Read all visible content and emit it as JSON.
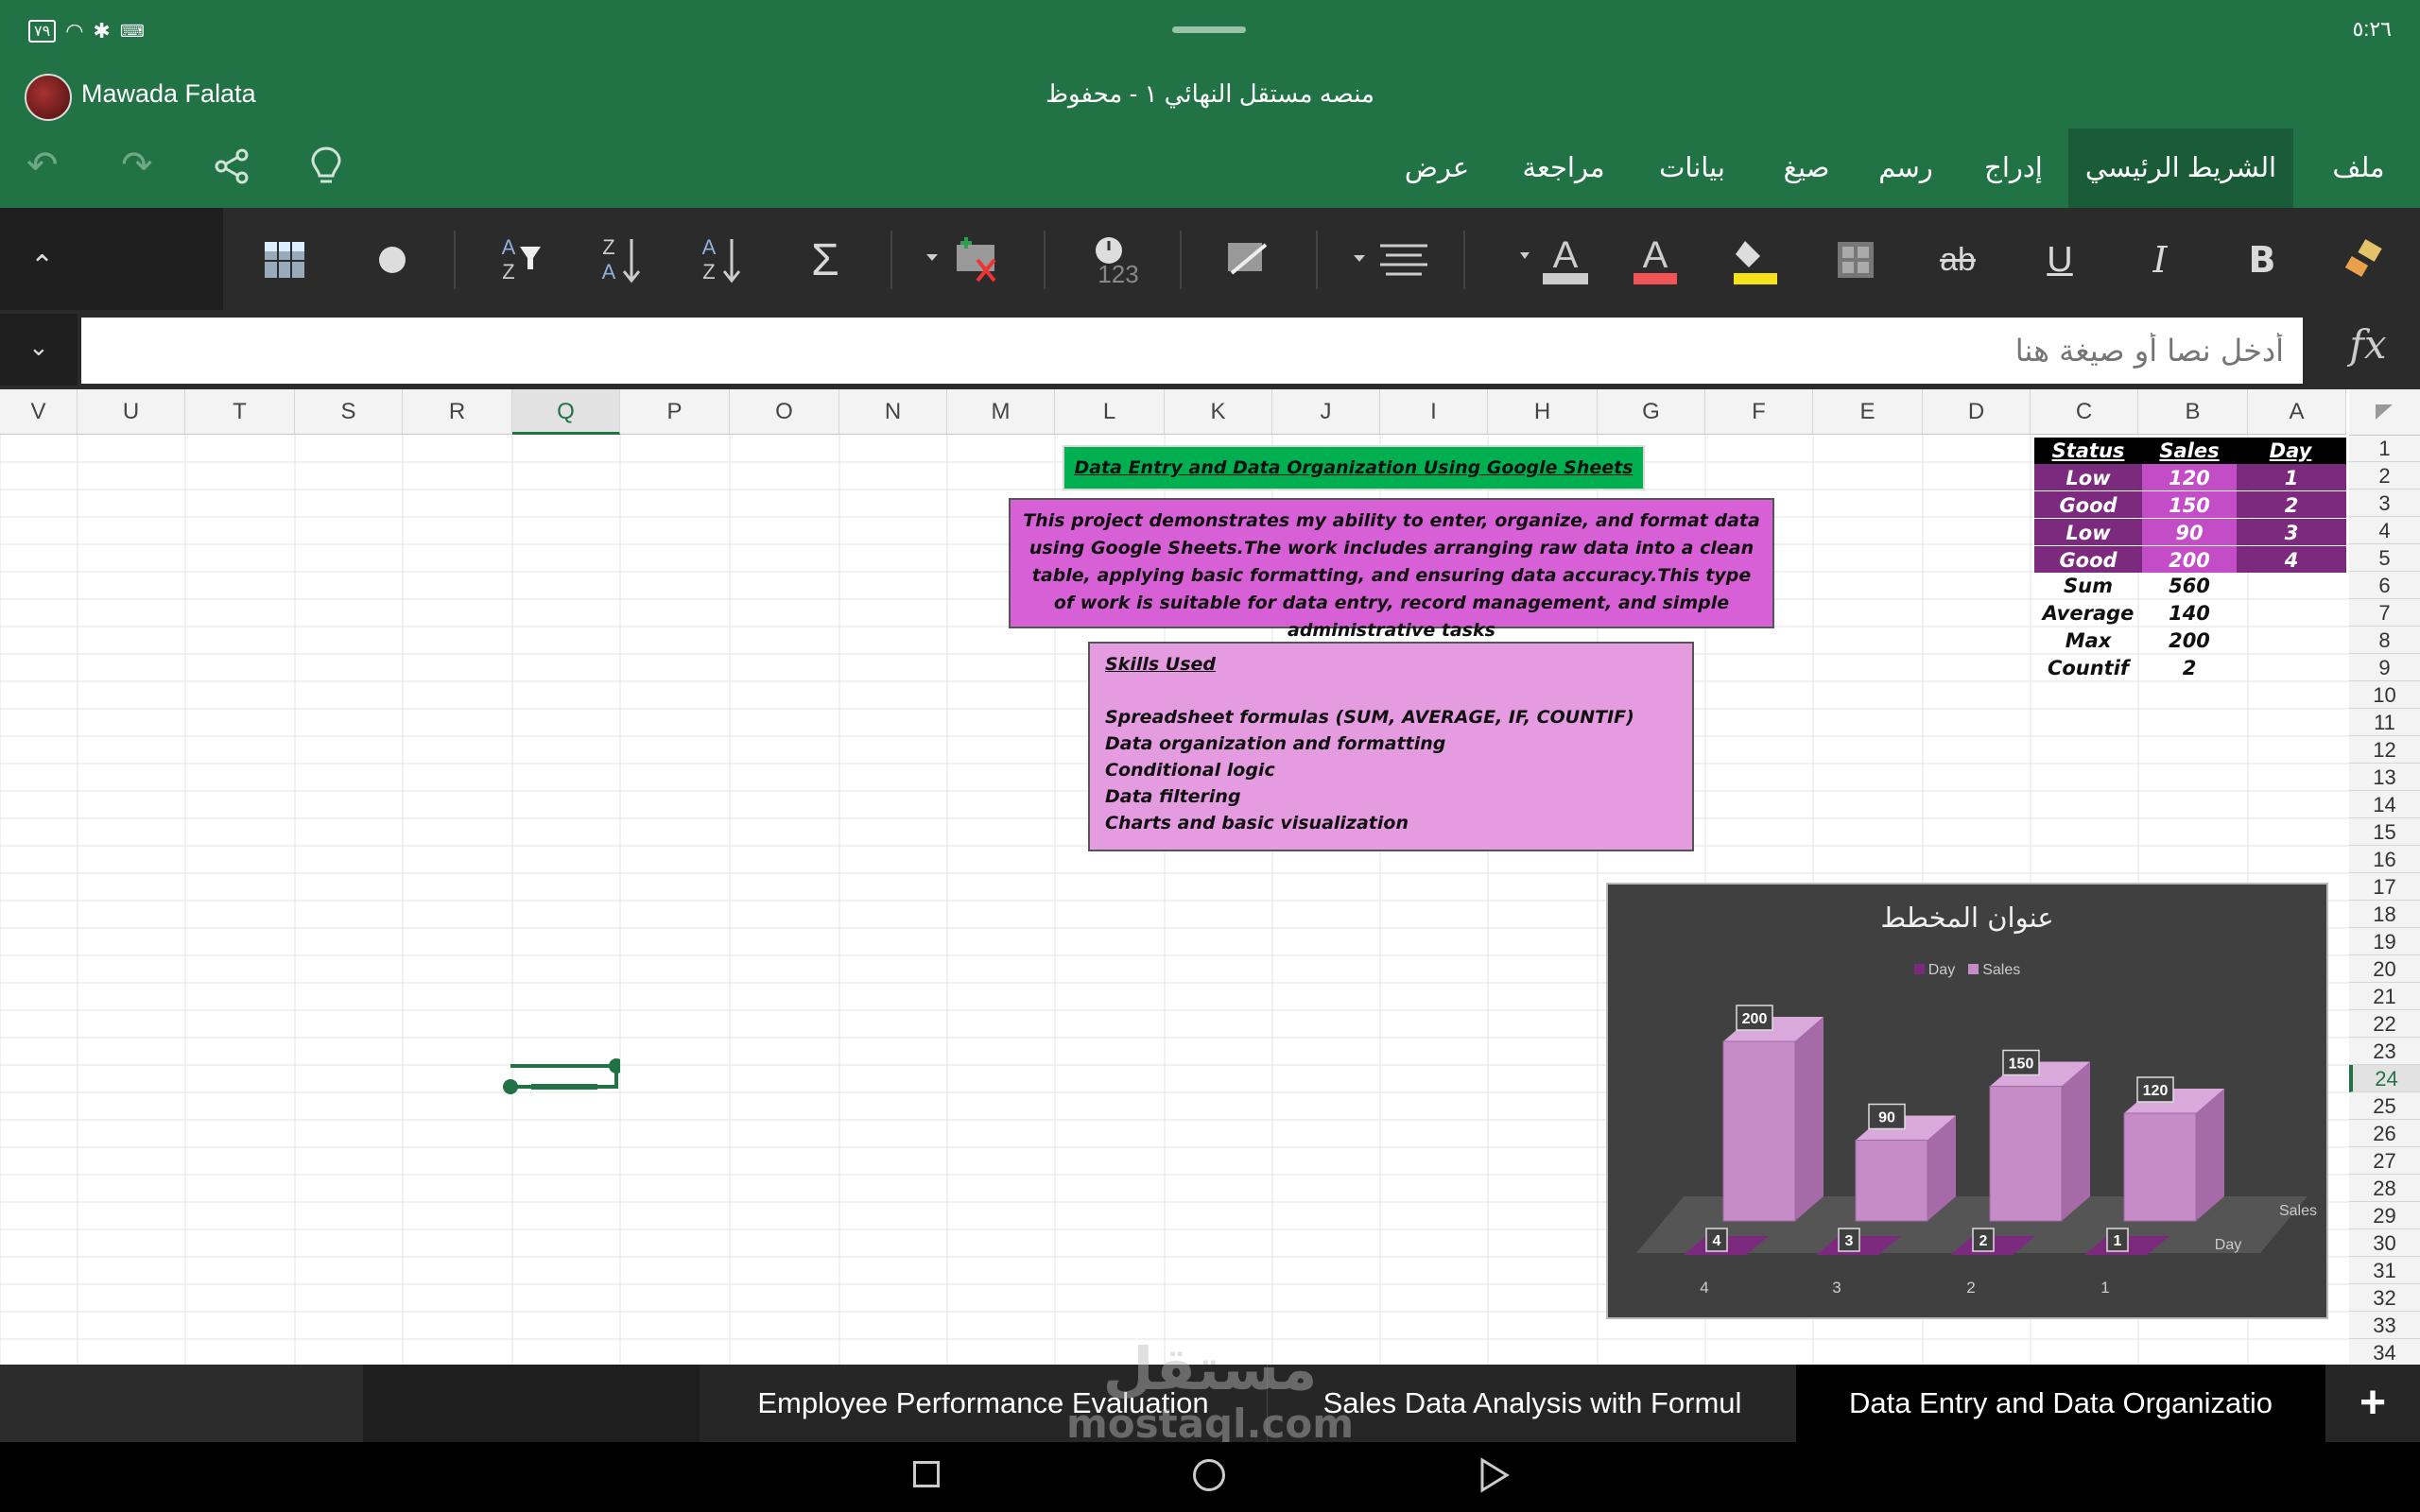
{
  "status_bar": {
    "time": "٥:٢٦",
    "battery": "٧٩"
  },
  "title_bar": {
    "user_name": "Mawada Falata",
    "document_title": "منصه مستقل النهائي ١ - محفوظ"
  },
  "menu_tabs": [
    "ملف",
    "الشريط الرئيسي",
    "إدراج",
    "رسم",
    "صيغ",
    "بيانات",
    "مراجعة",
    "عرض"
  ],
  "active_menu_tab": "الشريط الرئيسي",
  "ribbon_icons": [
    "format-painter-icon",
    "bold-icon",
    "italic-icon",
    "underline-icon",
    "strikethrough-icon",
    "borders-icon",
    "fill-color-icon",
    "font-color-icon",
    "align-icon",
    "conditional-format-icon",
    "number-format-icon",
    "delete-cells-icon",
    "autosum-icon",
    "sort-ascending-icon",
    "sort-descending-icon",
    "sort-filter-icon",
    "circle-icon",
    "table-icon"
  ],
  "formula_bar": {
    "placeholder": "أدخل نصا أو صيغة هنا",
    "fx_label": "fx"
  },
  "columns": [
    "A",
    "B",
    "C",
    "D",
    "E",
    "F",
    "G",
    "H",
    "I",
    "J",
    "K",
    "L",
    "M",
    "N",
    "O",
    "P",
    "Q",
    "R",
    "S",
    "T",
    "U",
    "V"
  ],
  "rows": [
    "1",
    "2",
    "3",
    "4",
    "5",
    "6",
    "7",
    "8",
    "9",
    "10",
    "11",
    "12",
    "13",
    "14",
    "15",
    "16",
    "17",
    "18",
    "19",
    "20",
    "21",
    "22",
    "23",
    "24",
    "25",
    "26",
    "27",
    "28",
    "29",
    "30",
    "31",
    "32",
    "33",
    "34"
  ],
  "table": {
    "headers": {
      "day": "Day",
      "sales": "Sales",
      "status": "Status"
    },
    "rows": [
      {
        "day": "1",
        "sales": "120",
        "status": "Low"
      },
      {
        "day": "2",
        "sales": "150",
        "status": "Good"
      },
      {
        "day": "3",
        "sales": "90",
        "status": "Low"
      },
      {
        "day": "4",
        "sales": "200",
        "status": "Good"
      }
    ],
    "summary": [
      {
        "label": "Sum",
        "value": "560"
      },
      {
        "label": "Average",
        "value": "140"
      },
      {
        "label": "Max",
        "value": "200"
      },
      {
        "label": "Countif",
        "value": "2"
      }
    ]
  },
  "title_box": "Data Entry and Data Organization Using Google Sheets",
  "description_box": "This project demonstrates my ability to enter, organize, and format data using Google Sheets.The work includes arranging raw data into a clean table, applying basic formatting, and ensuring data accuracy.This type of work is suitable for data entry, record management, and simple administrative tasks",
  "skills_box": {
    "heading": "Skills Used",
    "items": [
      "Spreadsheet formulas (SUM, AVERAGE, IF, COUNTIF)",
      "Data organization and formatting",
      "Conditional logic",
      "Data filtering",
      "Charts and basic visualization"
    ]
  },
  "chart_data": {
    "type": "bar",
    "title": "عنوان المخطط",
    "categories": [
      "4",
      "3",
      "2",
      "1"
    ],
    "series": [
      {
        "name": "Day",
        "values": [
          4,
          3,
          2,
          1
        ]
      },
      {
        "name": "Sales",
        "values": [
          200,
          90,
          150,
          120
        ]
      }
    ],
    "depth_axis_labels": [
      "Sales",
      "Day"
    ],
    "legend": "top",
    "colors": {
      "Day": "#7b2a7e",
      "Sales": "#c68cc8",
      "background": "#404040"
    }
  },
  "sheet_tabs": [
    "Employee Performance Evaluation",
    "Sales Data Analysis with Formul",
    "Data Entry and Data Organizatio"
  ],
  "active_sheet": "Data Entry and Data Organizatio",
  "add_sheet": "+",
  "watermark": {
    "line1": "مستقل",
    "line2": "mostaql.com"
  },
  "selected_row": "24",
  "selected_column": "Q",
  "colors": {
    "accent": "#217346",
    "ribbon": "#2b2b2b",
    "purple_dark": "#7b2a7e",
    "purple_mid": "#c34cc7",
    "pink": "#e39ee0",
    "green_title": "#00b050"
  }
}
